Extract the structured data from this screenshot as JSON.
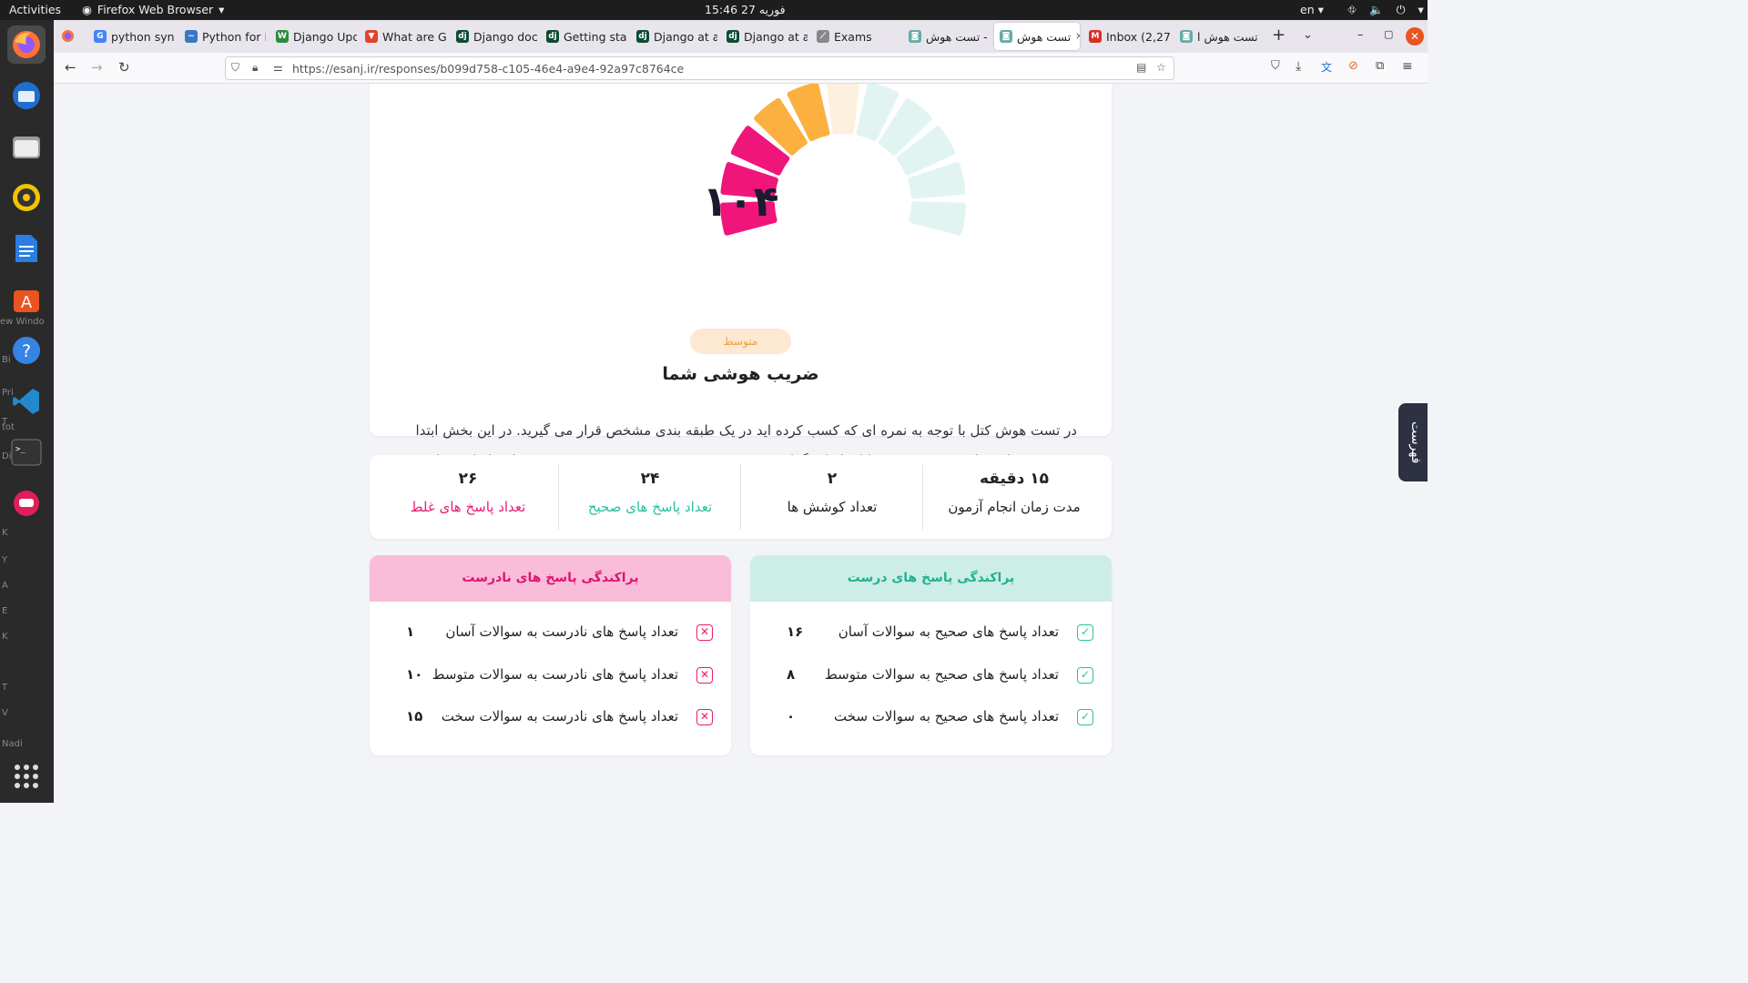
{
  "system": {
    "activities": "Activities",
    "app_name": "Firefox Web Browser",
    "clock": "15:46  27 فوریه",
    "lang": "en"
  },
  "dock": {
    "ghost_texts": [
      "ew  Windo",
      "Bi",
      "Pri",
      "T",
      "tot",
      "Di",
      "K",
      "Y",
      "A",
      "E",
      "K",
      "T",
      "V",
      "Nadi"
    ]
  },
  "tabs": [
    {
      "label": "python synt",
      "icon": "google-icon",
      "color": "#4285f4",
      "glyph": "G"
    },
    {
      "label": "Python for E",
      "icon": "python-icon",
      "color": "#3a78c2",
      "glyph": "~"
    },
    {
      "label": "Django Upd",
      "icon": "w-icon",
      "color": "#2d8a3e",
      "glyph": "W"
    },
    {
      "label": "What are Gi",
      "icon": "gitlab-icon",
      "color": "#e24329",
      "glyph": "▼"
    },
    {
      "label": "Django doc",
      "icon": "django-icon",
      "color": "#0c4b33",
      "glyph": "dj"
    },
    {
      "label": "Getting star",
      "icon": "django-icon",
      "color": "#0c4b33",
      "glyph": "dj"
    },
    {
      "label": "Django at a",
      "icon": "django-icon",
      "color": "#0c4b33",
      "glyph": "dj"
    },
    {
      "label": "Django at a",
      "icon": "django-icon",
      "color": "#0c4b33",
      "glyph": "dj"
    },
    {
      "label": "Exams",
      "icon": "exam-icon",
      "color": "#888888",
      "glyph": "⟋"
    },
    {
      "label": "تست هوش -",
      "icon": "esanj-icon",
      "color": "#6aa",
      "glyph": "◙"
    },
    {
      "label": "تست هوش",
      "icon": "esanj-icon",
      "color": "#6aa",
      "glyph": "◙"
    },
    {
      "label": "Inbox (2,278",
      "icon": "gmail-icon",
      "color": "#d93025",
      "glyph": "M"
    },
    {
      "label": "تست هوش ا",
      "icon": "esanj-icon",
      "color": "#6aa",
      "glyph": "◙"
    }
  ],
  "nav": {
    "url": "https://esanj.ir/responses/b099d758-c105-46e4-a9e4-92a97c8764ce"
  },
  "result": {
    "iq_value": "۱۰۴",
    "level": "متوسط",
    "title": "ضریب هوشی شما",
    "description": "در تست هوش کتل با توجه به نمره ای که کسب کرده اید در یک طبقه بندی مشخص قرار می گیرید. در این بخش ابتدا وضعیت شما در طبقه بندی عمومی یا استاندارد گزارش می شود. سپس در قسمت دوم وضعیت شما بر اساس سایر طبقه بندی ها مشخص می گردد."
  },
  "stats": {
    "duration": {
      "value": "۱۵ دقیقه",
      "label": "مدت زمان انجام آزمون"
    },
    "attempts": {
      "value": "۲",
      "label": "تعداد کوشش ها"
    },
    "correct": {
      "value": "۲۴",
      "label": "تعداد پاسخ های صحیح"
    },
    "wrong": {
      "value": "۲۶",
      "label": "تعداد پاسخ های غلط"
    }
  },
  "correct_dist": {
    "title": "پراکندگی پاسخ های درست",
    "rows": [
      {
        "label": "تعداد پاسخ های صحیح به سوالات آسان",
        "value": "۱۶"
      },
      {
        "label": "تعداد پاسخ های صحیح به سوالات متوسط",
        "value": "۸"
      },
      {
        "label": "تعداد پاسخ های صحیح به سوالات سخت",
        "value": "۰"
      }
    ]
  },
  "wrong_dist": {
    "title": "پراکندگی پاسخ های نادرست",
    "rows": [
      {
        "label": "تعداد پاسخ های نادرست به سوالات آسان",
        "value": "۱"
      },
      {
        "label": "تعداد پاسخ های نادرست به سوالات متوسط",
        "value": "۱۰"
      },
      {
        "label": "تعداد پاسخ های نادرست به سوالات سخت",
        "value": "۱۵"
      }
    ]
  },
  "side_tab": "فهرست",
  "colors": {
    "pink": "#f0157b",
    "orange": "#fbb040",
    "orange_light": "#fdf0df",
    "teal_light": "#e2f4f1",
    "teal": "#2bbf9e",
    "pink_head": "#f9bdd9",
    "teal_head": "#cdeee6"
  }
}
